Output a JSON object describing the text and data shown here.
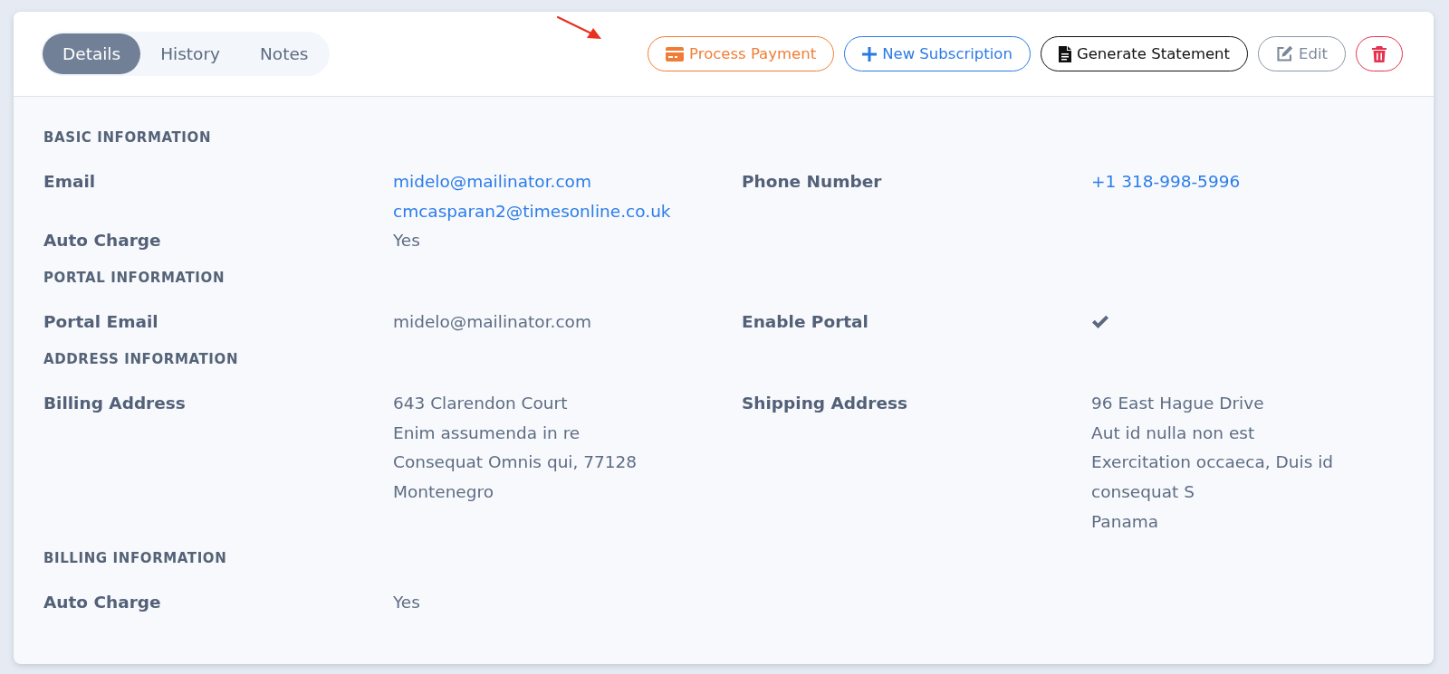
{
  "tabs": [
    {
      "label": "Details",
      "selected": true
    },
    {
      "label": "History",
      "selected": false
    },
    {
      "label": "Notes",
      "selected": false
    }
  ],
  "actions": [
    {
      "kind": "payment",
      "label": "Process Payment"
    },
    {
      "kind": "subscription",
      "label": "New Subscription"
    },
    {
      "kind": "statement",
      "label": "Generate Statement"
    },
    {
      "kind": "edit",
      "label": "Edit"
    },
    {
      "kind": "delete"
    }
  ],
  "sections": [
    {
      "title": "BASIC INFORMATION",
      "rows": [
        {
          "fields": [
            {
              "label": "Email",
              "kind": "link",
              "lines": [
                "midelo@mailinator.com",
                "cmcasparan2@timesonline.co.uk"
              ]
            },
            {
              "label": "Phone Number",
              "kind": "link",
              "lines": [
                "+1 318-998-5996"
              ]
            }
          ]
        },
        {
          "fields": [
            {
              "label": "Auto Charge",
              "kind": "text",
              "lines": [
                "Yes"
              ]
            }
          ]
        }
      ]
    },
    {
      "title": "PORTAL INFORMATION",
      "rows": [
        {
          "fields": [
            {
              "label": "Portal Email",
              "kind": "text",
              "lines": [
                "midelo@mailinator.com"
              ]
            },
            {
              "label": "Enable Portal",
              "kind": "check",
              "checked": true
            }
          ]
        }
      ]
    },
    {
      "title": "ADDRESS INFORMATION",
      "rows": [
        {
          "fields": [
            {
              "label": "Billing Address",
              "kind": "text",
              "lines": [
                "643 Clarendon Court",
                "Enim assumenda in re",
                "Consequat Omnis qui, 77128",
                "Montenegro"
              ]
            },
            {
              "label": "Shipping Address",
              "kind": "text",
              "lines": [
                "96 East Hague Drive",
                "Aut id nulla non est",
                "Exercitation occaeca, Duis id consequat S",
                "Panama"
              ]
            }
          ]
        }
      ]
    },
    {
      "title": "BILLING INFORMATION",
      "rows": [
        {
          "fields": [
            {
              "label": "Auto Charge",
              "kind": "text",
              "lines": [
                "Yes"
              ]
            }
          ]
        }
      ]
    }
  ]
}
